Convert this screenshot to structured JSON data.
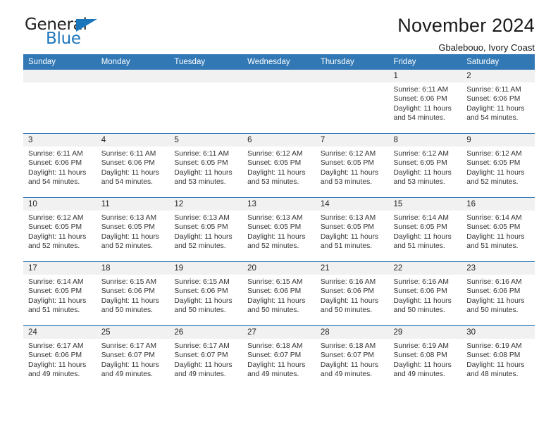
{
  "brand": {
    "name_part1": "General",
    "name_part2": "Blue",
    "accent_color": "#1b75bb"
  },
  "header": {
    "title": "November 2024",
    "subtitle": "Gbalebouo, Ivory Coast"
  },
  "calendar": {
    "header_color": "#3178b5",
    "weekdays": [
      "Sunday",
      "Monday",
      "Tuesday",
      "Wednesday",
      "Thursday",
      "Friday",
      "Saturday"
    ],
    "weeks": [
      [
        {
          "day": "",
          "sunrise": "",
          "sunset": "",
          "daylight1": "",
          "daylight2": "",
          "blank": true
        },
        {
          "day": "",
          "sunrise": "",
          "sunset": "",
          "daylight1": "",
          "daylight2": "",
          "blank": true
        },
        {
          "day": "",
          "sunrise": "",
          "sunset": "",
          "daylight1": "",
          "daylight2": "",
          "blank": true
        },
        {
          "day": "",
          "sunrise": "",
          "sunset": "",
          "daylight1": "",
          "daylight2": "",
          "blank": true
        },
        {
          "day": "",
          "sunrise": "",
          "sunset": "",
          "daylight1": "",
          "daylight2": "",
          "blank": true
        },
        {
          "day": "1",
          "sunrise": "Sunrise: 6:11 AM",
          "sunset": "Sunset: 6:06 PM",
          "daylight1": "Daylight: 11 hours",
          "daylight2": "and 54 minutes."
        },
        {
          "day": "2",
          "sunrise": "Sunrise: 6:11 AM",
          "sunset": "Sunset: 6:06 PM",
          "daylight1": "Daylight: 11 hours",
          "daylight2": "and 54 minutes."
        }
      ],
      [
        {
          "day": "3",
          "sunrise": "Sunrise: 6:11 AM",
          "sunset": "Sunset: 6:06 PM",
          "daylight1": "Daylight: 11 hours",
          "daylight2": "and 54 minutes."
        },
        {
          "day": "4",
          "sunrise": "Sunrise: 6:11 AM",
          "sunset": "Sunset: 6:06 PM",
          "daylight1": "Daylight: 11 hours",
          "daylight2": "and 54 minutes."
        },
        {
          "day": "5",
          "sunrise": "Sunrise: 6:11 AM",
          "sunset": "Sunset: 6:05 PM",
          "daylight1": "Daylight: 11 hours",
          "daylight2": "and 53 minutes."
        },
        {
          "day": "6",
          "sunrise": "Sunrise: 6:12 AM",
          "sunset": "Sunset: 6:05 PM",
          "daylight1": "Daylight: 11 hours",
          "daylight2": "and 53 minutes."
        },
        {
          "day": "7",
          "sunrise": "Sunrise: 6:12 AM",
          "sunset": "Sunset: 6:05 PM",
          "daylight1": "Daylight: 11 hours",
          "daylight2": "and 53 minutes."
        },
        {
          "day": "8",
          "sunrise": "Sunrise: 6:12 AM",
          "sunset": "Sunset: 6:05 PM",
          "daylight1": "Daylight: 11 hours",
          "daylight2": "and 53 minutes."
        },
        {
          "day": "9",
          "sunrise": "Sunrise: 6:12 AM",
          "sunset": "Sunset: 6:05 PM",
          "daylight1": "Daylight: 11 hours",
          "daylight2": "and 52 minutes."
        }
      ],
      [
        {
          "day": "10",
          "sunrise": "Sunrise: 6:12 AM",
          "sunset": "Sunset: 6:05 PM",
          "daylight1": "Daylight: 11 hours",
          "daylight2": "and 52 minutes."
        },
        {
          "day": "11",
          "sunrise": "Sunrise: 6:13 AM",
          "sunset": "Sunset: 6:05 PM",
          "daylight1": "Daylight: 11 hours",
          "daylight2": "and 52 minutes."
        },
        {
          "day": "12",
          "sunrise": "Sunrise: 6:13 AM",
          "sunset": "Sunset: 6:05 PM",
          "daylight1": "Daylight: 11 hours",
          "daylight2": "and 52 minutes."
        },
        {
          "day": "13",
          "sunrise": "Sunrise: 6:13 AM",
          "sunset": "Sunset: 6:05 PM",
          "daylight1": "Daylight: 11 hours",
          "daylight2": "and 52 minutes."
        },
        {
          "day": "14",
          "sunrise": "Sunrise: 6:13 AM",
          "sunset": "Sunset: 6:05 PM",
          "daylight1": "Daylight: 11 hours",
          "daylight2": "and 51 minutes."
        },
        {
          "day": "15",
          "sunrise": "Sunrise: 6:14 AM",
          "sunset": "Sunset: 6:05 PM",
          "daylight1": "Daylight: 11 hours",
          "daylight2": "and 51 minutes."
        },
        {
          "day": "16",
          "sunrise": "Sunrise: 6:14 AM",
          "sunset": "Sunset: 6:05 PM",
          "daylight1": "Daylight: 11 hours",
          "daylight2": "and 51 minutes."
        }
      ],
      [
        {
          "day": "17",
          "sunrise": "Sunrise: 6:14 AM",
          "sunset": "Sunset: 6:05 PM",
          "daylight1": "Daylight: 11 hours",
          "daylight2": "and 51 minutes."
        },
        {
          "day": "18",
          "sunrise": "Sunrise: 6:15 AM",
          "sunset": "Sunset: 6:06 PM",
          "daylight1": "Daylight: 11 hours",
          "daylight2": "and 50 minutes."
        },
        {
          "day": "19",
          "sunrise": "Sunrise: 6:15 AM",
          "sunset": "Sunset: 6:06 PM",
          "daylight1": "Daylight: 11 hours",
          "daylight2": "and 50 minutes."
        },
        {
          "day": "20",
          "sunrise": "Sunrise: 6:15 AM",
          "sunset": "Sunset: 6:06 PM",
          "daylight1": "Daylight: 11 hours",
          "daylight2": "and 50 minutes."
        },
        {
          "day": "21",
          "sunrise": "Sunrise: 6:16 AM",
          "sunset": "Sunset: 6:06 PM",
          "daylight1": "Daylight: 11 hours",
          "daylight2": "and 50 minutes."
        },
        {
          "day": "22",
          "sunrise": "Sunrise: 6:16 AM",
          "sunset": "Sunset: 6:06 PM",
          "daylight1": "Daylight: 11 hours",
          "daylight2": "and 50 minutes."
        },
        {
          "day": "23",
          "sunrise": "Sunrise: 6:16 AM",
          "sunset": "Sunset: 6:06 PM",
          "daylight1": "Daylight: 11 hours",
          "daylight2": "and 50 minutes."
        }
      ],
      [
        {
          "day": "24",
          "sunrise": "Sunrise: 6:17 AM",
          "sunset": "Sunset: 6:06 PM",
          "daylight1": "Daylight: 11 hours",
          "daylight2": "and 49 minutes."
        },
        {
          "day": "25",
          "sunrise": "Sunrise: 6:17 AM",
          "sunset": "Sunset: 6:07 PM",
          "daylight1": "Daylight: 11 hours",
          "daylight2": "and 49 minutes."
        },
        {
          "day": "26",
          "sunrise": "Sunrise: 6:17 AM",
          "sunset": "Sunset: 6:07 PM",
          "daylight1": "Daylight: 11 hours",
          "daylight2": "and 49 minutes."
        },
        {
          "day": "27",
          "sunrise": "Sunrise: 6:18 AM",
          "sunset": "Sunset: 6:07 PM",
          "daylight1": "Daylight: 11 hours",
          "daylight2": "and 49 minutes."
        },
        {
          "day": "28",
          "sunrise": "Sunrise: 6:18 AM",
          "sunset": "Sunset: 6:07 PM",
          "daylight1": "Daylight: 11 hours",
          "daylight2": "and 49 minutes."
        },
        {
          "day": "29",
          "sunrise": "Sunrise: 6:19 AM",
          "sunset": "Sunset: 6:08 PM",
          "daylight1": "Daylight: 11 hours",
          "daylight2": "and 49 minutes."
        },
        {
          "day": "30",
          "sunrise": "Sunrise: 6:19 AM",
          "sunset": "Sunset: 6:08 PM",
          "daylight1": "Daylight: 11 hours",
          "daylight2": "and 48 minutes."
        }
      ]
    ]
  }
}
